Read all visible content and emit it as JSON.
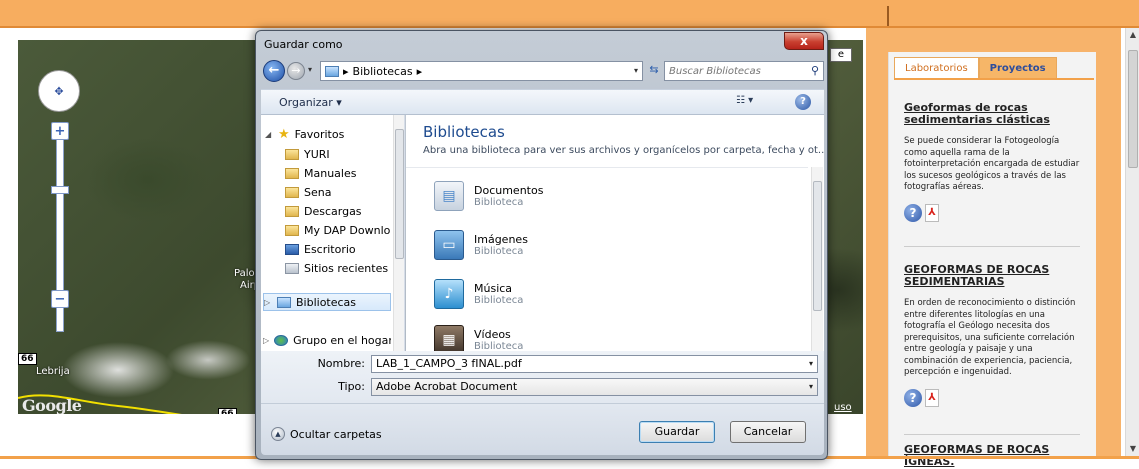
{
  "map": {
    "labels": {
      "place1": "Palor",
      "place2": "Airp",
      "town": "Lebrija",
      "route_shield": "66",
      "route_shield_2": "66"
    },
    "google_logo": "Google",
    "map_type_button": "e",
    "terms_link": "uso"
  },
  "sidebar": {
    "tabs": [
      {
        "label": "Laboratorios",
        "active": true
      },
      {
        "label": "Proyectos",
        "active": false
      }
    ],
    "articles": [
      {
        "title": "Geoformas de rocas sedimentarias clásticas",
        "body": "Se puede considerar la Fotogeología como aquella rama de la fotointerpretación encargada de estudiar los sucesos geológicos a través de las fotografías aéreas."
      },
      {
        "title": "GEOFORMAS DE ROCAS SEDIMENTARIAS",
        "body": "En orden de reconocimiento o distinción entre diferentes litologías en una fotografía el Geólogo necesita dos prerequisitos, una suficiente correlación entre geología y paisaje y una combinación de experiencia, paciencia, percepción e ingenuidad."
      },
      {
        "title": "GEOFORMAS DE ROCAS ÍGNEAS.",
        "body": ""
      }
    ]
  },
  "dialog": {
    "title": "Guardar como",
    "close_label": "x",
    "address": {
      "path_label": "Bibliotecas",
      "chevron": "▸"
    },
    "search": {
      "placeholder": "Buscar Bibliotecas"
    },
    "toolbar": {
      "organize_label": "Organizar ▾",
      "help_label": "?"
    },
    "nav": {
      "favorites_label": "Favoritos",
      "items": [
        "YURI",
        "Manuales",
        "Sena",
        "Descargas",
        "My DAP Downlo",
        "Escritorio",
        "Sitios recientes"
      ],
      "libraries_label": "Bibliotecas",
      "homegroup_label": "Grupo en el hogar"
    },
    "content": {
      "title": "Bibliotecas",
      "description": "Abra una biblioteca para ver sus archivos y organícelos por carpeta, fecha y ot...",
      "libraries": [
        {
          "name": "Documentos",
          "type": "Biblioteca",
          "color": "#4a86c8"
        },
        {
          "name": "Imágenes",
          "type": "Biblioteca",
          "color": "#3a79b8"
        },
        {
          "name": "Música",
          "type": "Biblioteca",
          "color": "#2d8fd0"
        },
        {
          "name": "Vídeos",
          "type": "Biblioteca",
          "color": "#5a4a3c"
        }
      ]
    },
    "form": {
      "name_label": "Nombre:",
      "name_value": "LAB_1_CAMPO_3 fINAL.pdf",
      "type_label": "Tipo:",
      "type_value": "Adobe Acrobat Document"
    },
    "footer": {
      "hide_folders_label": "Ocultar carpetas",
      "save_label": "Guardar",
      "cancel_label": "Cancelar"
    }
  }
}
